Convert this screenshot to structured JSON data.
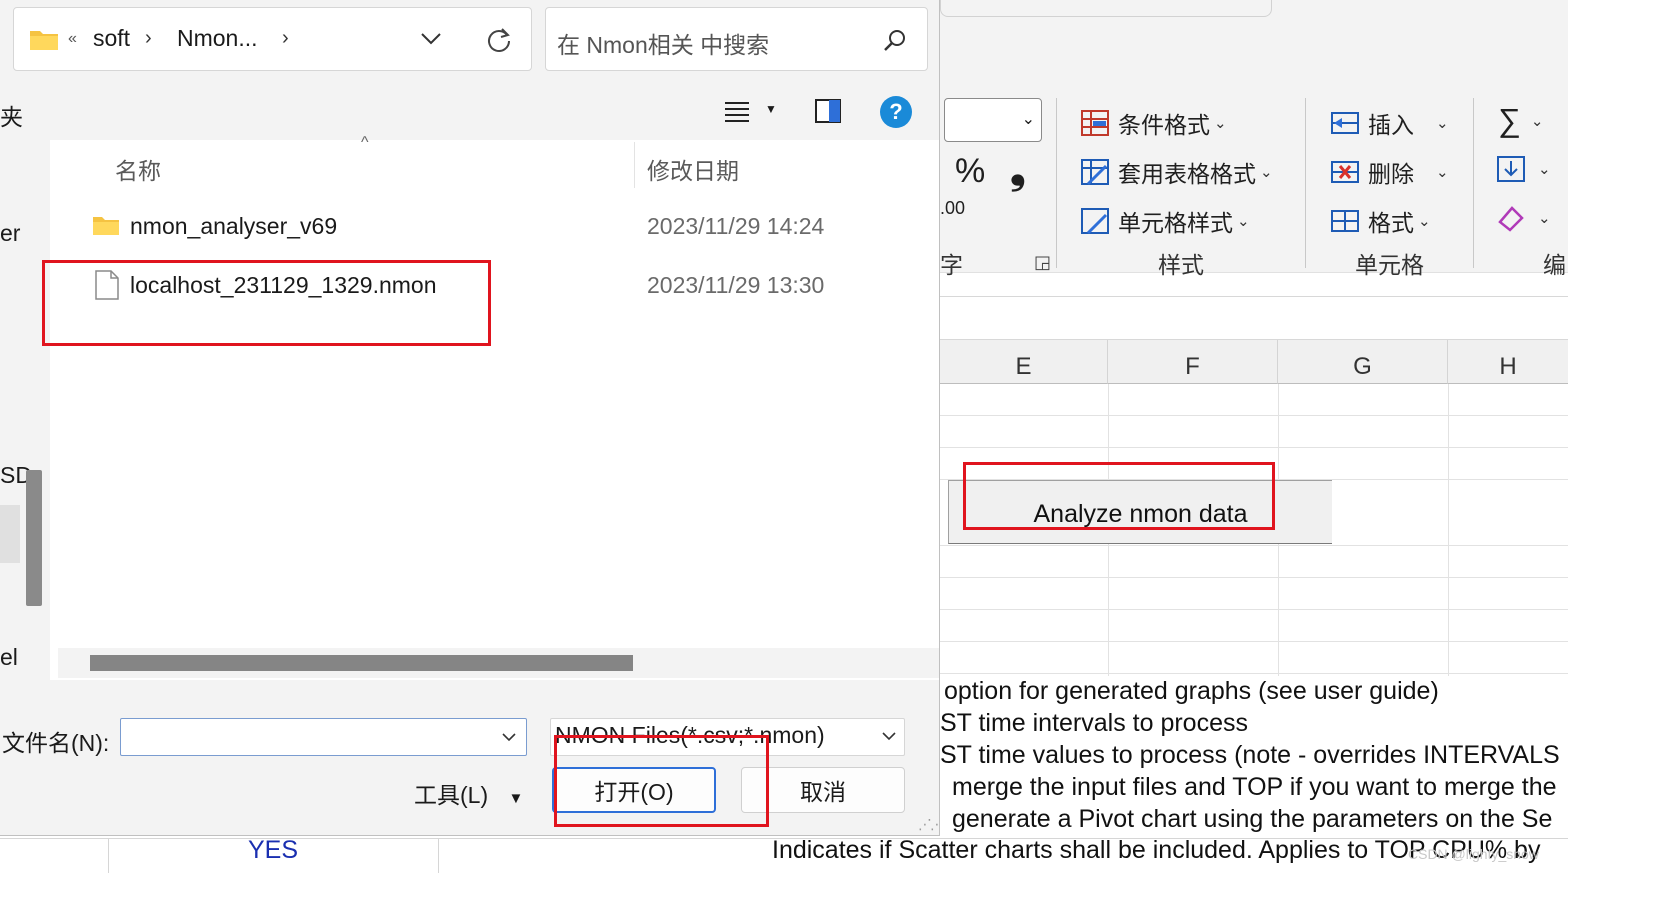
{
  "dialog": {
    "breadcrumb": {
      "overflow": "«",
      "items": [
        "soft",
        "Nmon..."
      ]
    },
    "search_placeholder": "在 Nmon相关 中搜索",
    "nav_fragments": [
      "夹",
      "er",
      "SD",
      "el"
    ],
    "columns": {
      "name": "名称",
      "date": "修改日期"
    },
    "files": [
      {
        "name": "nmon_analyser_v69",
        "date": "2023/11/29 14:24",
        "icon": "folder-icon"
      },
      {
        "name": "localhost_231129_1329.nmon",
        "date": "2023/11/29 13:30",
        "icon": "file-icon"
      }
    ],
    "filename_label": "文件名(N):",
    "filename_value": "",
    "filetype_value": "NMON Files(*.csv;*.nmon)",
    "tools_label": "工具(L)",
    "open_label": "打开(O)",
    "cancel_label": "取消",
    "help_glyph": "?"
  },
  "excel": {
    "ribbon": {
      "number_group": {
        "percent": "%",
        "comma": "❟",
        "decimals": ".00",
        "label_fragment": "字"
      },
      "styles": {
        "conditional": "条件格式",
        "table": "套用表格格式",
        "cell": "单元格样式",
        "group": "样式"
      },
      "cells": {
        "insert": "插入",
        "delete": "删除",
        "format": "格式",
        "group": "单元格"
      },
      "editing": {
        "sum": "∑",
        "group_fragment": "编"
      }
    },
    "column_headers": [
      "E",
      "F",
      "G",
      "H"
    ],
    "analyze_button": "Analyze nmon data",
    "param_lines": [
      "option for generated graphs (see user guide)",
      "ST time intervals to process",
      "ST time values to process (note - overrides INTERVALS",
      "merge the input files and TOP if you want to merge the",
      "generate a Pivot chart using the parameters on the Se"
    ],
    "yes_cell": "YES",
    "bottom_text": "Indicates if Scatter charts shall be included.  Applies to TOP CPU% by",
    "watermark": "CSDN @lighty_snow"
  }
}
